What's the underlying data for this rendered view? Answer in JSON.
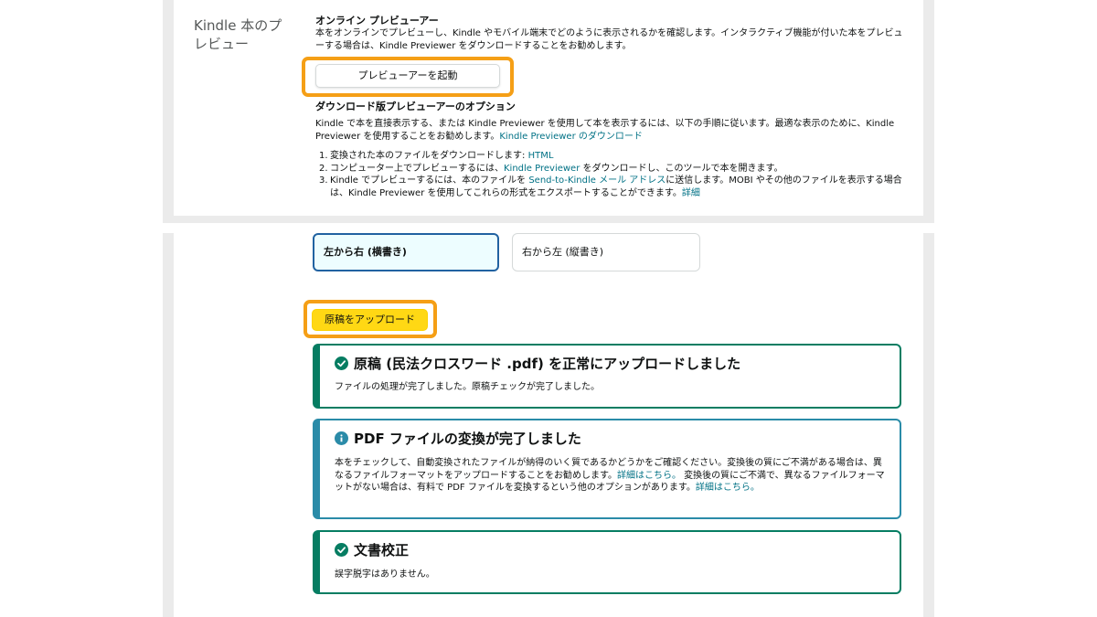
{
  "preview": {
    "section_title": "Kindle 本のプレビュー",
    "online_heading": "オンライン プレビューアー",
    "online_desc": "本をオンラインでプレビューし、Kindle やモバイル端末でどのように表示されるかを確認します。インタラクティブ機能が付いた本をプレビューする場合は、Kindle Previewer をダウンロードすることをお勧めします。",
    "launch_button": "プレビューアーを起動",
    "download_heading": "ダウンロード版プレビューアーのオプション",
    "download_desc": "Kindle で本を直接表示する、または Kindle Previewer を使用して本を表示するには、以下の手順に従います。最適な表示のために、Kindle Previewer を使用することをお勧めします。",
    "download_link": "Kindle Previewer のダウンロード",
    "steps": [
      {
        "num": "1.",
        "text": "変換された本のファイルをダウンロードします: ",
        "link": "HTML",
        "after": ""
      },
      {
        "num": "2.",
        "text": "コンピューター上でプレビューするには、",
        "link": "Kindle Previewer",
        "after": " をダウンロードし、このツールで本を開きます。"
      },
      {
        "num": "3.",
        "text": "Kindle でプレビューするには、本のファイルを ",
        "link": "Send-to-Kindle メール アドレス",
        "after": "に送信します。MOBI やその他のファイルを表示する場合は、Kindle Previewer を使用してこれらの形式をエクスポートすることができます。",
        "link2": "詳細"
      }
    ]
  },
  "direction": {
    "ltr": "左から右 (横書き)",
    "rtl": "右から左 (縦書き)"
  },
  "upload_button": "原稿をアップロード",
  "alerts": {
    "upload": {
      "title": "原稿 (民法クロスワード .pdf) を正常にアップロードしました",
      "body": "ファイルの処理が完了しました。原稿チェックが完了しました。"
    },
    "convert": {
      "title": "PDF ファイルの変換が完了しました",
      "body1": "本をチェックして、自動変換されたファイルが納得のいく質であるかどうかをご確認ください。変換後の質にご不満がある場合は、異なるファイルフォーマットをアップロードすることをお勧めします。",
      "link1": "詳細はこちら。",
      "body2": " 変換後の質にご不満で、異なるファイルフォーマットがない場合は、有料で PDF ファイルを変換するという他のオプションがあります。",
      "link2": "詳細はこちら。"
    },
    "proof": {
      "title": "文書校正",
      "body": "誤字脱字はありません。"
    }
  },
  "colors": {
    "success": "#067d62",
    "info": "#2a8ba8",
    "highlight": "#f59f16",
    "link": "#007185",
    "upload_button": "#ffd814"
  }
}
